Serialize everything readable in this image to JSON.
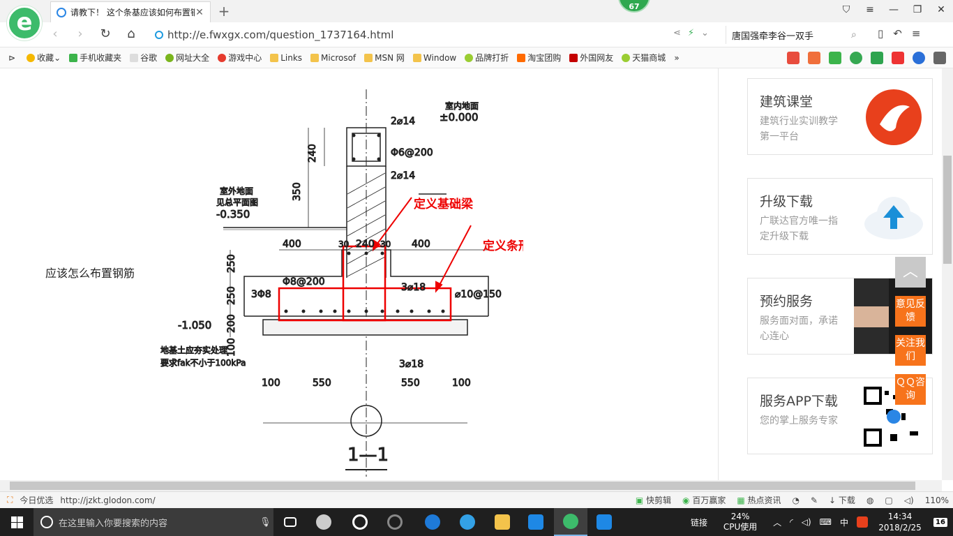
{
  "browser": {
    "logo_letter": "e",
    "badge": "67",
    "tab": {
      "title": "请教下！ 这个条基应该如何布置钢筋",
      "close": "✕"
    },
    "new_tab": "+",
    "address": {
      "url": "http://e.fwxgx.com/question_1737164.html"
    },
    "search": {
      "query": "唐国强牵李谷一双手"
    },
    "bookmarks": [
      {
        "label": "收藏"
      },
      {
        "label": "手机收藏夹"
      },
      {
        "label": "谷歌"
      },
      {
        "label": "网址大全"
      },
      {
        "label": "游戏中心"
      },
      {
        "label": "Links"
      },
      {
        "label": "Microsof"
      },
      {
        "label": "MSN 网"
      },
      {
        "label": "Window"
      },
      {
        "label": "品牌打折"
      },
      {
        "label": "淘宝团购"
      },
      {
        "label": "外国网友"
      },
      {
        "label": "天猫商城"
      }
    ],
    "bookmarks_more": "»"
  },
  "page": {
    "question": "应该怎么布置钢筋",
    "drawing": {
      "annot_beam": "定义基础梁",
      "annot_strip": "定义条形基础",
      "indoor_floor_label": "室内地面",
      "indoor_floor_level": "±0.000",
      "outdoor_label_1": "室外地面",
      "outdoor_label_2": "见总平面图",
      "outdoor_level": "-0.350",
      "bottom_level": "-1.050",
      "top_bar": "2⌀14",
      "stirrup_top": "Φ6@200",
      "mid_bar": "2⌀14",
      "beam_stirrup": "Φ8@200",
      "beam_top": "3⌀18",
      "beam_bottom": "3⌀18",
      "side_bar": "3Φ8",
      "dist_bar": "⌀10@150",
      "dim_240": "240",
      "dim_350": "350",
      "dim_250a": "250",
      "dim_250b": "250",
      "dim_200": "200",
      "dim_100": "100",
      "dim_400l": "400",
      "dim_30l": "30",
      "dim_240b": "240",
      "dim_30r": "30",
      "dim_400r": "400",
      "dim_100l": "100",
      "dim_550l": "550",
      "dim_550r": "550",
      "dim_100r": "100",
      "soil_note_1": "地基土应夯实处理",
      "soil_note_2": "要求fak不小于100kPa",
      "section_label": "1—1"
    }
  },
  "sidebar": {
    "cards": [
      {
        "title": "建筑课堂",
        "desc": "建筑行业实训教学第一平台",
        "icon": "glodon-logo-icon",
        "color": "#e8401c"
      },
      {
        "title": "升级下载",
        "desc": "广联达官方唯一指定升级下载",
        "icon": "cloud-upload-icon",
        "color": "#1a8fd8"
      },
      {
        "title": "预约服务",
        "desc": "服务面对面，承诺心连心",
        "icon": "handshake-photo",
        "color": "#333333"
      },
      {
        "title": "服务APP下载",
        "desc": "您的掌上服务专家",
        "icon": "qr-code-icon",
        "color": "#000000"
      }
    ],
    "float": {
      "top": "︿",
      "feedback": "意见反馈",
      "follow": "关注我们",
      "qq": "ＱＱ咨询"
    }
  },
  "statusbar": {
    "left_label": "今日优选",
    "link": "http://jzkt.glodon.com/",
    "items": [
      "快剪辑",
      "百万赢家",
      "热点资讯",
      "下载"
    ],
    "zoom": "110%"
  },
  "taskbar": {
    "search_placeholder": "在这里输入你要搜索的内容",
    "tray_link": "链接",
    "cpu_pct": "24%",
    "cpu_label": "CPU使用",
    "ime": "中",
    "time": "14:34",
    "date": "2018/2/25",
    "notifications": "16"
  }
}
